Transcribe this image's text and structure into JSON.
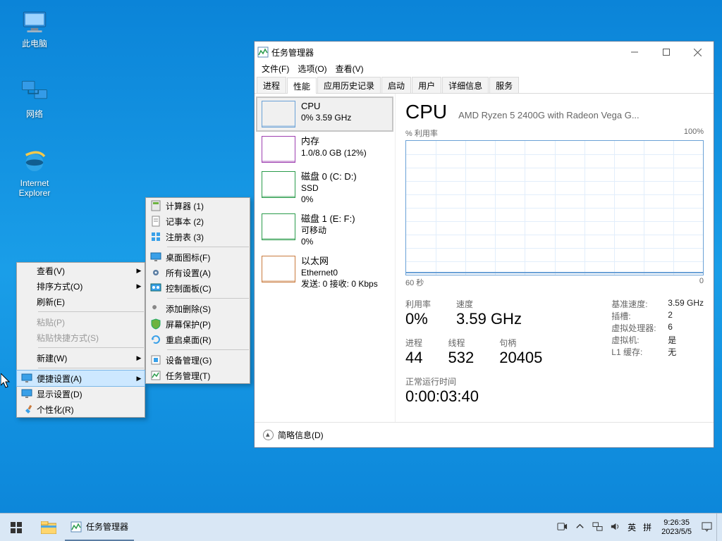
{
  "desktop": {
    "icons": [
      {
        "label": "此电脑"
      },
      {
        "label": "网络"
      },
      {
        "label": "Internet\nExplorer"
      }
    ]
  },
  "ctx_a": [
    {
      "t": "查看(V)",
      "arrow": true
    },
    {
      "t": "排序方式(O)",
      "arrow": true
    },
    {
      "t": "刷新(E)"
    },
    {
      "sep": true
    },
    {
      "t": "粘贴(P)",
      "disabled": true
    },
    {
      "t": "粘贴快捷方式(S)",
      "disabled": true
    },
    {
      "sep": true
    },
    {
      "t": "新建(W)",
      "arrow": true
    },
    {
      "sep": true
    },
    {
      "t": "便捷设置(A)",
      "arrow": true,
      "hl": true,
      "icon": "monitor"
    },
    {
      "t": "显示设置(D)",
      "icon": "monitor"
    },
    {
      "t": "个性化(R)",
      "icon": "brush"
    }
  ],
  "ctx_b": [
    {
      "t": "计算器  (1)",
      "icon": "calc"
    },
    {
      "t": "记事本  (2)",
      "icon": "note"
    },
    {
      "t": "注册表  (3)",
      "icon": "cubes"
    },
    {
      "sep": true
    },
    {
      "t": "桌面图标(F)",
      "icon": "monitor"
    },
    {
      "t": "所有设置(A)",
      "icon": "gear"
    },
    {
      "t": "控制面板(C)",
      "icon": "panel"
    },
    {
      "sep": true
    },
    {
      "t": "添加删除(S)",
      "icon": "wrench"
    },
    {
      "t": "屏幕保护(P)",
      "icon": "shield"
    },
    {
      "t": "重启桌面(R)",
      "icon": "reload"
    },
    {
      "sep": true
    },
    {
      "t": "设备管理(G)",
      "icon": "device"
    },
    {
      "t": "任务管理(T)",
      "icon": "task"
    }
  ],
  "tm": {
    "title": "任务管理器",
    "menus": [
      "文件(F)",
      "选项(O)",
      "查看(V)"
    ],
    "tabs": [
      "进程",
      "性能",
      "应用历史记录",
      "启动",
      "用户",
      "详细信息",
      "服务"
    ],
    "active_tab": 1,
    "left": [
      {
        "h": "CPU",
        "v": "0% 3.59 GHz",
        "cls": "cpu",
        "sel": true
      },
      {
        "h": "内存",
        "v": "1.0/8.0 GB (12%)",
        "cls": "mem"
      },
      {
        "h": "磁盘 0 (C: D:)",
        "v": "SSD",
        "v2": "0%",
        "cls": "dsk0"
      },
      {
        "h": "磁盘 1 (E: F:)",
        "v": "可移动",
        "v2": "0%",
        "cls": "dsk1"
      },
      {
        "h": "以太网",
        "v": "Ethernet0",
        "v2": "发送: 0 接收: 0 Kbps",
        "cls": "eth"
      }
    ],
    "right": {
      "big": "CPU",
      "sub": "AMD Ryzen 5 2400G with Radeon Vega G...",
      "chart_lbl_l": "% 利用率",
      "chart_lbl_r": "100%",
      "axis_l": "60 秒",
      "axis_r": "0",
      "stats": [
        {
          "lbl": "利用率",
          "val": "0%"
        },
        {
          "lbl": "速度",
          "val": "3.59 GHz"
        }
      ],
      "info": [
        {
          "k": "基准速度:",
          "v": "3.59 GHz"
        },
        {
          "k": "插槽:",
          "v": "2"
        },
        {
          "k": "虚拟处理器:",
          "v": "6"
        },
        {
          "k": "虚拟机:",
          "v": "是"
        },
        {
          "k": "L1 缓存:",
          "v": "无"
        }
      ],
      "stats2": [
        {
          "lbl": "进程",
          "val": "44"
        },
        {
          "lbl": "线程",
          "val": "532"
        },
        {
          "lbl": "句柄",
          "val": "20405"
        }
      ],
      "uptime_lbl": "正常运行时间",
      "uptime_val": "0:00:03:40"
    },
    "footer": "简略信息(D)"
  },
  "taskbar": {
    "task_label": "任务管理器",
    "ime1": "英",
    "ime2": "拼",
    "time": "9:26:35",
    "date": "2023/5/5"
  },
  "chart_data": {
    "type": "line",
    "title": "% 利用率",
    "ylabel": "% 利用率",
    "xlabel": "秒",
    "xlim": [
      0,
      60
    ],
    "ylim": [
      0,
      100
    ],
    "series": [
      {
        "name": "CPU 利用率",
        "x": [
          0,
          6,
          12,
          18,
          24,
          30,
          36,
          42,
          48,
          54,
          60
        ],
        "values": [
          1,
          1,
          1,
          1,
          1,
          1,
          1,
          1,
          1,
          1,
          1
        ]
      }
    ]
  }
}
